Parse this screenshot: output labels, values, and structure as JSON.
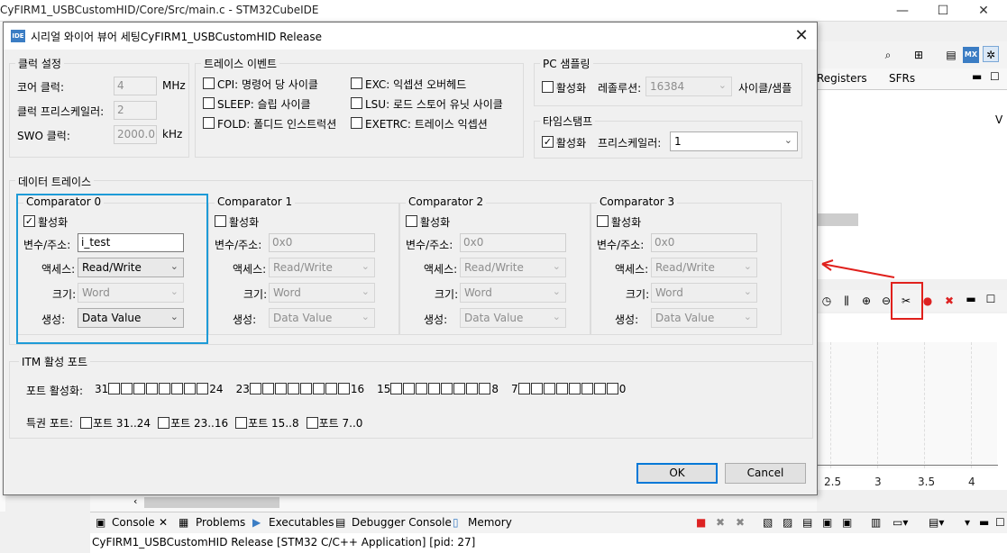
{
  "ide": {
    "window_title": "CyFIRM1_USBCustomHID/Core/Src/main.c - STM32CubeIDE",
    "controls": {
      "minimize": "—",
      "maximize": "☐",
      "close": "✕"
    },
    "right_panel": {
      "toolbar_icons": [
        "search-icon",
        "perspective-icon",
        "ide-perspective-icon",
        "mx-icon",
        "debug-perspective-icon"
      ],
      "mx_label": "MX",
      "tabs": [
        "Registers",
        "SFRs"
      ],
      "pane_text": "V",
      "graph_axis_ticks": [
        "2.5",
        "3",
        "3.5",
        "4"
      ]
    },
    "bottom_tabs": [
      "Console",
      "Problems",
      "Executables",
      "Debugger Console",
      "Memory"
    ],
    "status": "CyFIRM1_USBCustomHID Release [STM32 C/C++ Application]  [pid: 27]"
  },
  "dialog": {
    "title": "시리얼 와이어 뷰어 세팅CyFIRM1_USBCustomHID Release",
    "icon_label": "IDE",
    "clock": {
      "legend": "클럭 설정",
      "core_label": "코어 클럭:",
      "core_value": "4",
      "core_unit": "MHz",
      "prescaler_label": "클럭 프리스케일러:",
      "prescaler_value": "2",
      "swo_label": "SWO 클럭:",
      "swo_value": "2000.0",
      "swo_unit": "kHz"
    },
    "trace_events": {
      "legend": "트레이스 이벤트",
      "items": [
        {
          "label": "CPI: 명령어 당 사이클",
          "checked": false
        },
        {
          "label": "EXC: 익셉션 오버헤드",
          "checked": false
        },
        {
          "label": "SLEEP: 슬립 사이클",
          "checked": false
        },
        {
          "label": "LSU: 로드 스토어 유닛 사이클",
          "checked": false
        },
        {
          "label": "FOLD: 폴디드 인스트럭션",
          "checked": false
        },
        {
          "label": "EXETRC: 트레이스 익셉션",
          "checked": false
        }
      ]
    },
    "pc_sampling": {
      "legend": "PC 샘플링",
      "enable_label": "활성화",
      "enable_checked": false,
      "resolution_label": "레졸루션:",
      "resolution_value": "16384",
      "unit": "사이클/샘플"
    },
    "timestamp": {
      "legend": "타임스탬프",
      "enable_label": "활성화",
      "enable_checked": true,
      "prescaler_label": "프리스케일러:",
      "prescaler_value": "1"
    },
    "data_trace": {
      "legend": "데이터 트레이스",
      "row_labels": {
        "enable": "활성화",
        "var": "변수/주소:",
        "access": "액세스:",
        "size": "크기:",
        "generate": "생성:"
      },
      "comparators": [
        {
          "legend": "Comparator 0",
          "enabled": true,
          "var": "i_test",
          "access": "Read/Write",
          "size": "Word",
          "generate": "Data Value"
        },
        {
          "legend": "Comparator 1",
          "enabled": false,
          "var": "0x0",
          "access": "Read/Write",
          "size": "Word",
          "generate": "Data Value"
        },
        {
          "legend": "Comparator 2",
          "enabled": false,
          "var": "0x0",
          "access": "Read/Write",
          "size": "Word",
          "generate": "Data Value"
        },
        {
          "legend": "Comparator 3",
          "enabled": false,
          "var": "0x0",
          "access": "Read/Write",
          "size": "Word",
          "generate": "Data Value"
        }
      ]
    },
    "itm": {
      "legend": "ITM 활성 포트",
      "ports_label": "포트 활성화:",
      "groups": [
        {
          "start": "31",
          "end": "24"
        },
        {
          "start": "23",
          "end": "16"
        },
        {
          "start": "15",
          "end": "8"
        },
        {
          "start": "7",
          "end": "0"
        }
      ],
      "priv_label": "특권 포트:",
      "priv_ports": [
        "포트 31..24",
        "포트 23..16",
        "포트 15..8",
        "포트 7..0"
      ]
    },
    "ok_label": "OK",
    "cancel_label": "Cancel"
  },
  "colors": {
    "highlight_blue": "#1e9bd7",
    "annotation_red": "#e0201c",
    "accent": "#0078d7"
  }
}
